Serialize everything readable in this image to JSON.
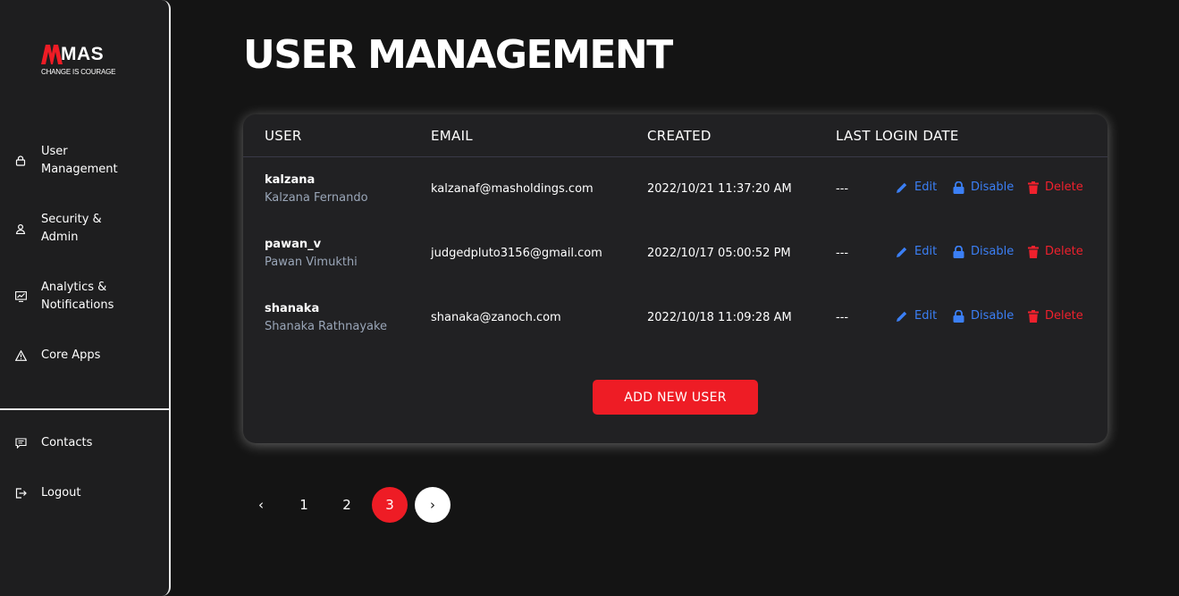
{
  "brand": {
    "name": "MAS",
    "tagline": "CHANGE IS COURAGE",
    "accent": "#ee1c25"
  },
  "sidebar": {
    "items": [
      {
        "label": "User Management",
        "icon": "lock-icon"
      },
      {
        "label": "Security & Admin",
        "icon": "user-icon"
      },
      {
        "label": "Analytics & Notifications",
        "icon": "chart-icon"
      },
      {
        "label": "Core Apps",
        "icon": "warning-triangle-icon"
      }
    ],
    "bottom_items": [
      {
        "label": "Contacts",
        "icon": "message-icon"
      },
      {
        "label": "Logout",
        "icon": "logout-icon"
      }
    ]
  },
  "page": {
    "title": "USER MANAGEMENT"
  },
  "table": {
    "columns": [
      "USER",
      "EMAIL",
      "CREATED",
      "LAST LOGIN DATE"
    ],
    "rows": [
      {
        "username": "kalzana",
        "full_name": "Kalzana Fernando",
        "email": "kalzanaf@masholdings.com",
        "created": "2022/10/21 11:37:20 AM",
        "last_login": "---"
      },
      {
        "username": "pawan_v",
        "full_name": "Pawan Vimukthi",
        "email": "judgedpluto3156@gmail.com",
        "created": "2022/10/17 05:00:52 PM",
        "last_login": "---"
      },
      {
        "username": "shanaka",
        "full_name": "Shanaka Rathnayake",
        "email": "shanaka@zanoch.com",
        "created": "2022/10/18 11:09:28 AM",
        "last_login": "---"
      }
    ],
    "actions": {
      "edit": "Edit",
      "disable": "Disable",
      "delete": "Delete"
    },
    "add_button": "ADD NEW USER"
  },
  "pagination": {
    "prev": "‹",
    "pages": [
      "1",
      "2",
      "3"
    ],
    "current": "3",
    "next": "›"
  }
}
